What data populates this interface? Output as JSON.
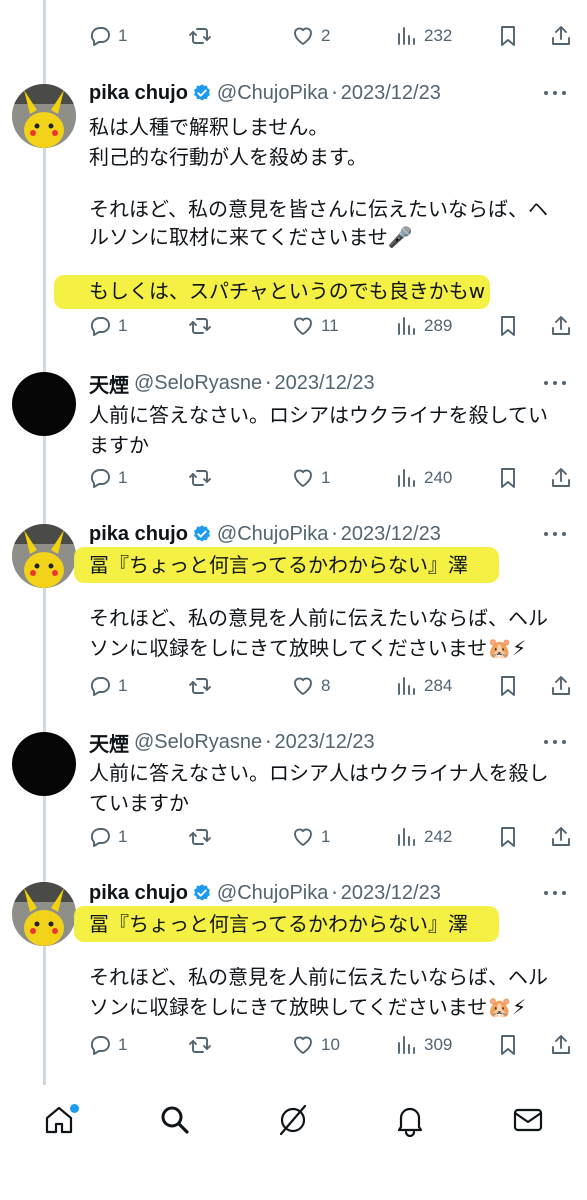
{
  "top_actions": {
    "replies": "1",
    "retweets": "",
    "likes": "2",
    "views": "232"
  },
  "tweets": [
    {
      "name": "pika chujo",
      "handle": "@ChujoPika",
      "sep": "·",
      "date": "2023/12/23",
      "verified": true,
      "lines": [
        "私は人種で解釈しません。",
        "利己的な行動が人を殺めます。",
        "",
        "それほど、私の意見を皆さんに伝えたいならば、ヘ",
        "ルソンに取材に来てくださいませ🎤",
        "",
        "もしくは、スパチャというのでも良きかもw"
      ],
      "actions": {
        "replies": "1",
        "retweets": "",
        "likes": "11",
        "views": "289"
      }
    },
    {
      "name": "天煙",
      "handle": "@SeloRyasne",
      "sep": "·",
      "date": "2023/12/23",
      "verified": false,
      "lines": [
        "人前に答えなさい。ロシアはウクライナを殺してい",
        "ますか"
      ],
      "actions": {
        "replies": "1",
        "retweets": "",
        "likes": "1",
        "views": "240"
      }
    },
    {
      "name": "pika chujo",
      "handle": "@ChujoPika",
      "sep": "·",
      "date": "2023/12/23",
      "verified": true,
      "lines": [
        "冨『ちょっと何言ってるかわからない』澤",
        "",
        "それほど、私の意見を人前に伝えたいならば、ヘル",
        "ソンに収録をしにきて放映してくださいませ🐹⚡"
      ],
      "actions": {
        "replies": "1",
        "retweets": "",
        "likes": "8",
        "views": "284"
      }
    },
    {
      "name": "天煙",
      "handle": "@SeloRyasne",
      "sep": "·",
      "date": "2023/12/23",
      "verified": false,
      "lines": [
        "人前に答えなさい。ロシア人はウクライナ人を殺し",
        "ていますか"
      ],
      "actions": {
        "replies": "1",
        "retweets": "",
        "likes": "1",
        "views": "242"
      }
    },
    {
      "name": "pika chujo",
      "handle": "@ChujoPika",
      "sep": "·",
      "date": "2023/12/23",
      "verified": true,
      "lines": [
        "冨『ちょっと何言ってるかわからない』澤",
        "",
        "それほど、私の意見を人前に伝えたいならば、ヘル",
        "ソンに収録をしにきて放映してくださいませ🐹⚡"
      ],
      "actions": {
        "replies": "1",
        "retweets": "",
        "likes": "10",
        "views": "309"
      }
    }
  ],
  "colors": {
    "accent": "#1d9bf0",
    "highlight": "#f4ef3a",
    "muted": "#536471",
    "thread": "#cfd9de"
  },
  "nav_icons": [
    "home-icon",
    "search-icon",
    "grok-icon",
    "notifications-icon",
    "messages-icon"
  ]
}
